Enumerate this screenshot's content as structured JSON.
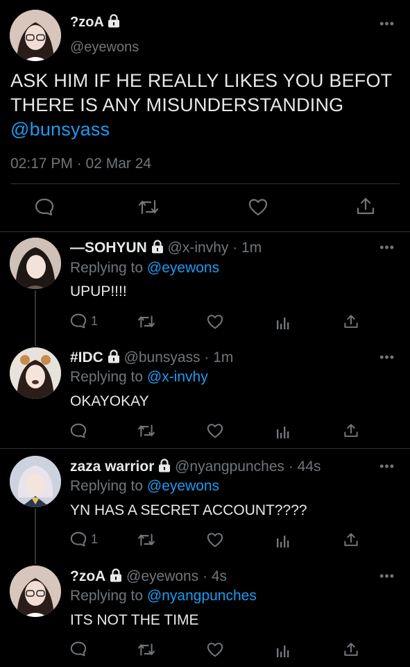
{
  "main_tweet": {
    "display_name": "?zoA",
    "handle": "@eyewons",
    "text_line1": "ASK HIM IF HE REALLY LIKES YOU BEFOT",
    "text_line2": "THERE IS ANY MISUNDERSTANDING",
    "mention": "@bunsyass",
    "timestamp": "02:17 PM · 02 Mar 24"
  },
  "replies": [
    {
      "display_name": "—SOHYUN",
      "meta": "@x-invhy · 1m",
      "replying_prefix": "Replying to",
      "replying_to": "@eyewons",
      "text": "UPUP!!!!",
      "reply_count": "1"
    },
    {
      "display_name": "#IDC",
      "meta": "@bunsyass · 1m",
      "replying_prefix": "Replying to",
      "replying_to": "@x-invhy",
      "text": "OKAYOKAY",
      "reply_count": ""
    },
    {
      "display_name": "zaza warrior",
      "meta": "@nyangpunches · 44s",
      "replying_prefix": "Replying to",
      "replying_to": "@eyewons",
      "text": "YN HAS A SECRET ACCOUNT????",
      "reply_count": "1"
    },
    {
      "display_name": "?zoA",
      "meta": "@eyewons · 4s",
      "replying_prefix": "Replying to",
      "replying_to": "@nyangpunches",
      "text": "ITS NOT THE TIME",
      "reply_count": ""
    }
  ],
  "colors": {
    "background": "#000000",
    "text": "#e7e9ea",
    "muted": "#71767b",
    "link": "#1d9bf0",
    "divider": "#2f3336"
  }
}
